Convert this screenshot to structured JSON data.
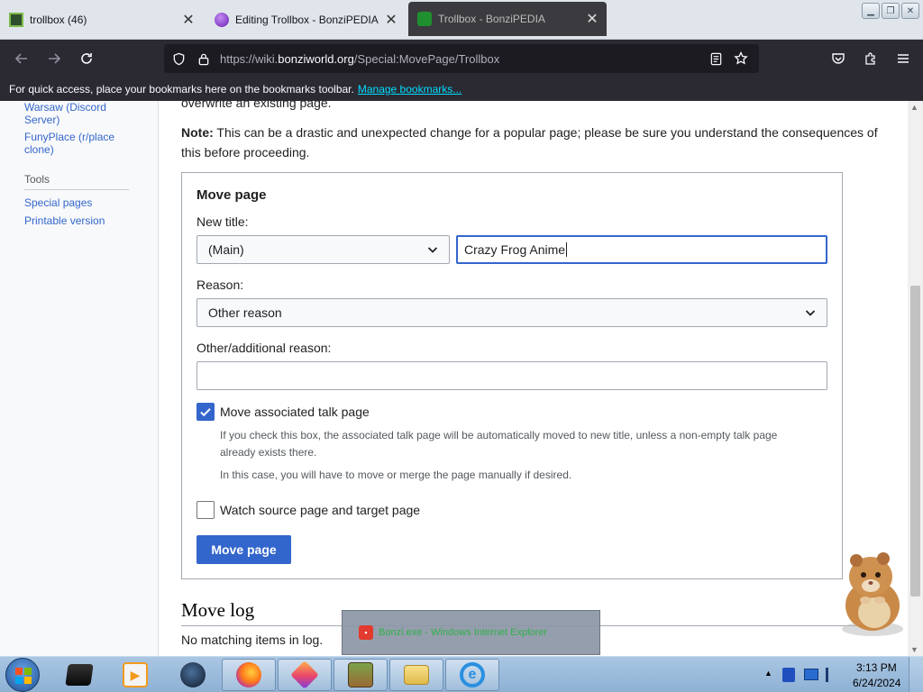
{
  "browser": {
    "tabs": [
      {
        "title": "trollbox (46)",
        "favicon": "trollbox-favicon"
      },
      {
        "title": "Editing Trollbox - BonziPEDIA",
        "favicon": "purple-orb-favicon"
      },
      {
        "title": "Trollbox - BonziPEDIA",
        "favicon": "bonzi-favicon"
      }
    ],
    "url_prefix": "https://wiki.",
    "url_host": "bonziworld.org",
    "url_path": "/Special:MovePage/Trollbox",
    "bookmarks_message": "For quick access, place your bookmarks here on the bookmarks toolbar.",
    "bookmarks_link": "Manage bookmarks..."
  },
  "sidebar": {
    "links_top": [
      "Warsaw (Discord Server)",
      "FunyPlace (r/place clone)"
    ],
    "tools_heading": "Tools",
    "tools_links": [
      "Special pages",
      "Printable version"
    ]
  },
  "content": {
    "overwrite_line": "overwrite an existing page.",
    "note_label": "Note:",
    "note_text": " This can be a drastic and unexpected change for a popular page; please be sure you understand the consequences of this before proceeding.",
    "form": {
      "legend": "Move page",
      "new_title_label": "New title:",
      "namespace_value": "(Main)",
      "title_value": "Crazy Frog Anime",
      "reason_label": "Reason:",
      "reason_value": "Other reason",
      "other_reason_label": "Other/additional reason:",
      "other_reason_value": "",
      "talk_label": "Move associated talk page",
      "talk_checked": true,
      "talk_help_1": "If you check this box, the associated talk page will be automatically moved to new title, unless a non-empty talk page already exists there.",
      "talk_help_2": "In this case, you will have to move or merge the page manually if desired.",
      "watch_label": "Watch source page and target page",
      "watch_checked": false,
      "submit_label": "Move page"
    },
    "move_log_heading": "Move log",
    "move_log_text": "No matching items in log."
  },
  "taskbar": {
    "popup_label": "Bonzi.exe - Windows Internet Explorer",
    "time": "3:13 PM",
    "date": "6/24/2024",
    "items": [
      "terminal-icon",
      "media-player-icon",
      "globe-icon",
      "firefox-icon",
      "crystal-icon",
      "bonzibox-icon",
      "file-explorer-icon",
      "internet-explorer-icon"
    ]
  },
  "colors": {
    "link": "#3366cc",
    "button": "#3366cc",
    "browser_dark": "#2b2a33",
    "taskbar": "#a9c6e3"
  }
}
